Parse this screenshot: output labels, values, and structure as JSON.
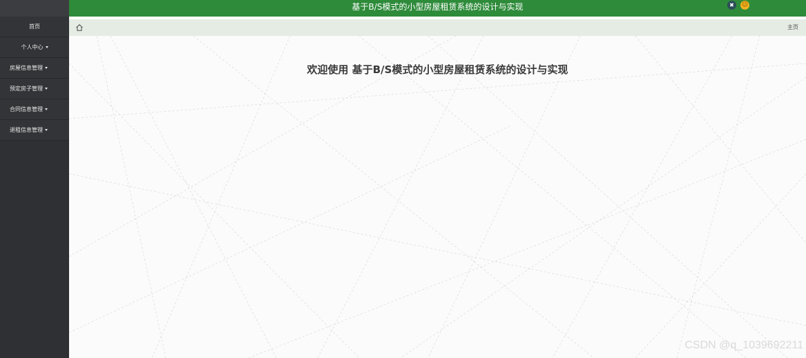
{
  "header": {
    "title": "基于B/S模式的小型房屋租赁系统的设计与实现",
    "switch_icon": "swap-icon",
    "user_icon": "user-avatar-icon",
    "user_glyph": "☺",
    "switch_glyph": "✖"
  },
  "sidebar": {
    "items": [
      {
        "label": "首页",
        "has_caret": false
      },
      {
        "label": "个人中心",
        "has_caret": true
      },
      {
        "label": "房屋信息管理",
        "has_caret": true
      },
      {
        "label": "预定房子管理",
        "has_caret": true
      },
      {
        "label": "合同信息管理",
        "has_caret": true
      },
      {
        "label": "退租信息管理",
        "has_caret": true
      }
    ]
  },
  "breadcrumb": {
    "home_icon": "home-icon",
    "right_label": "主页"
  },
  "main": {
    "welcome": "欢迎使用 基于B/S模式的小型房屋租赁系统的设计与实现"
  },
  "watermark": "CSDN @q_1039692211",
  "colors": {
    "header_green": "#2e8b3a",
    "sidebar_dark": "#2f3033",
    "breadcrumb_bg": "#e4ece3",
    "user_badge": "#f1b21e"
  }
}
